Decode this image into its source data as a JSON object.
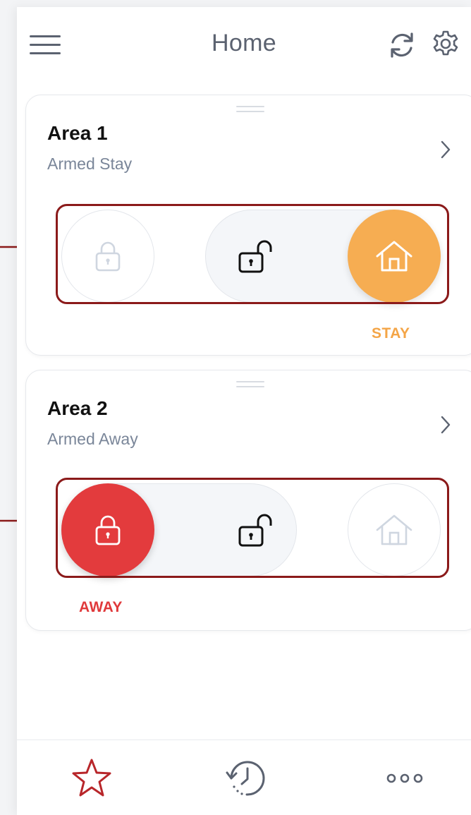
{
  "header": {
    "title": "Home",
    "icons": [
      "menu-icon",
      "refresh-icon",
      "gear-icon"
    ]
  },
  "areas": [
    {
      "name": "Area 1",
      "status": "Armed Stay",
      "selected_mode": "stay",
      "mode_label": "STAY",
      "mode_color": "#f6ad52"
    },
    {
      "name": "Area 2",
      "status": "Armed Away",
      "selected_mode": "away",
      "mode_label": "AWAY",
      "mode_color": "#e33b3d"
    }
  ],
  "switch_icons": [
    "lock-icon",
    "unlock-icon",
    "home-icon"
  ],
  "bottom_nav": {
    "items": [
      "star-icon",
      "history-icon",
      "more-icon"
    ],
    "active": "star-icon",
    "active_color": "#b8262a"
  },
  "colors": {
    "title": "#5b6270",
    "status_text": "#7a8699",
    "highlight_frame": "#8b1a1a"
  }
}
